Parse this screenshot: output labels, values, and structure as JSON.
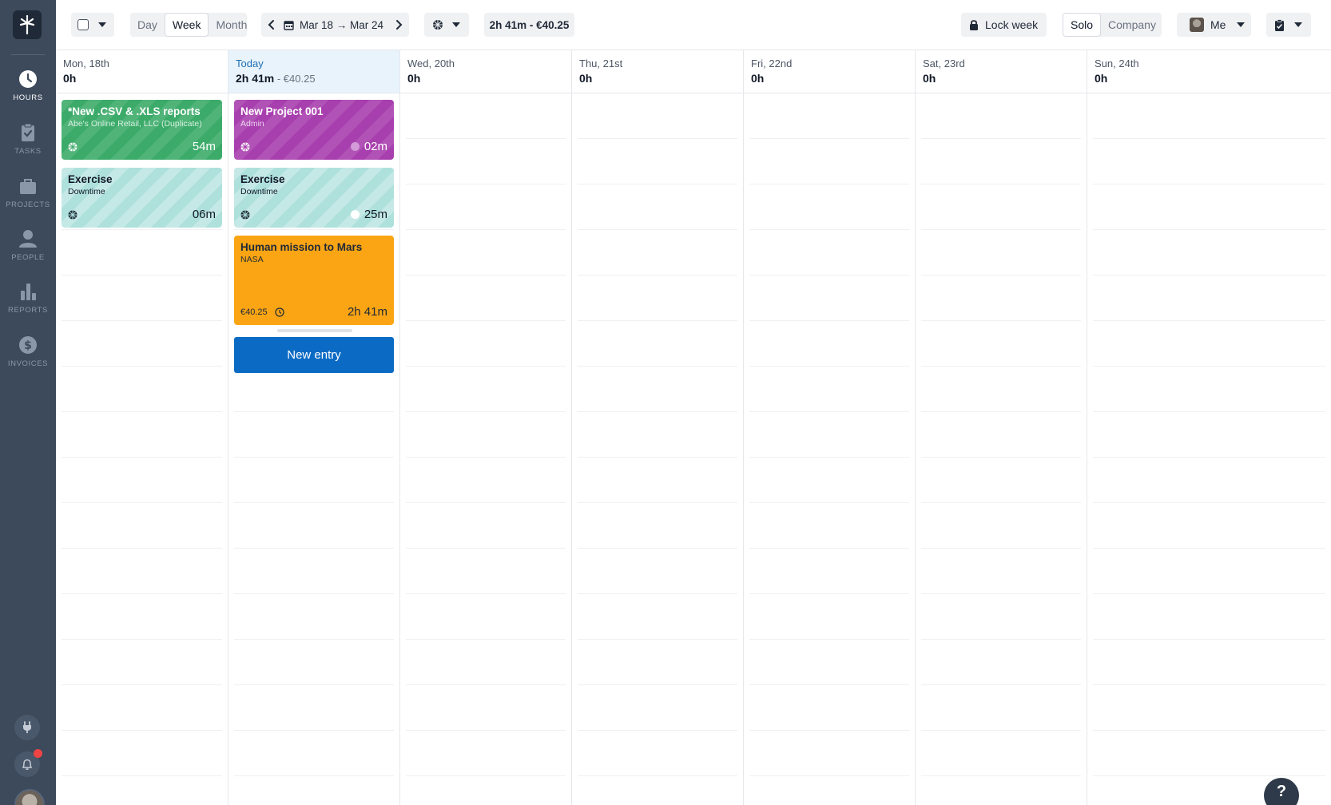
{
  "sidebar": {
    "nav": [
      {
        "label": "HOURS",
        "icon": "clock-icon",
        "active": true
      },
      {
        "label": "TASKS",
        "icon": "clipboard-check-icon",
        "active": false
      },
      {
        "label": "PROJECTS",
        "icon": "briefcase-icon",
        "active": false
      },
      {
        "label": "PEOPLE",
        "icon": "person-icon",
        "active": false
      },
      {
        "label": "REPORTS",
        "icon": "bar-chart-icon",
        "active": false
      },
      {
        "label": "INVOICES",
        "icon": "dollar-icon",
        "active": false
      }
    ],
    "bottom": [
      "plug-icon",
      "bell-icon",
      "avatar"
    ]
  },
  "toolbar": {
    "view_day": "Day",
    "view_week": "Week",
    "view_month": "Month",
    "selected_view": "Week",
    "date_range": "Mar 18 → Mar 24",
    "total": "2h 41m - €40.25",
    "lock_week": "Lock week",
    "scope_solo": "Solo",
    "scope_company": "Company",
    "selected_scope": "Solo",
    "user": "Me"
  },
  "days": [
    {
      "name": "Mon, 18th",
      "total": "0h",
      "amount": ""
    },
    {
      "name": "Today",
      "total": "2h 41m",
      "amount": " - €40.25"
    },
    {
      "name": "Wed, 20th",
      "total": "0h",
      "amount": ""
    },
    {
      "name": "Thu, 21st",
      "total": "0h",
      "amount": ""
    },
    {
      "name": "Fri, 22nd",
      "total": "0h",
      "amount": ""
    },
    {
      "name": "Sat, 23rd",
      "total": "0h",
      "amount": ""
    },
    {
      "name": "Sun, 24th",
      "total": "0h",
      "amount": ""
    }
  ],
  "entries": {
    "mon_csv": {
      "title": "*New .CSV & .XLS reports",
      "client": "Abe's Online Retail, LLC (Duplicate)",
      "duration": "54m"
    },
    "mon_exercise": {
      "title": "Exercise",
      "client": "Downtime",
      "duration": "06m"
    },
    "tue_project": {
      "title": "New Project 001",
      "client": "Admin",
      "duration": "02m"
    },
    "tue_exercise": {
      "title": "Exercise",
      "client": "Downtime",
      "duration": "25m"
    },
    "tue_mars": {
      "title": "Human mission to Mars",
      "client": "NASA",
      "amount": "€40.25",
      "duration": "2h 41m"
    }
  },
  "new_entry_label": "New entry",
  "help_label": "?",
  "colors": {
    "sidebar_bg": "#3c4a5b",
    "green": "#3cab6a",
    "purple": "#a83fae",
    "teal": "#aee0dc",
    "orange": "#fba514",
    "primary_blue": "#0b6bc4",
    "today_bg": "#e8f3fc"
  }
}
